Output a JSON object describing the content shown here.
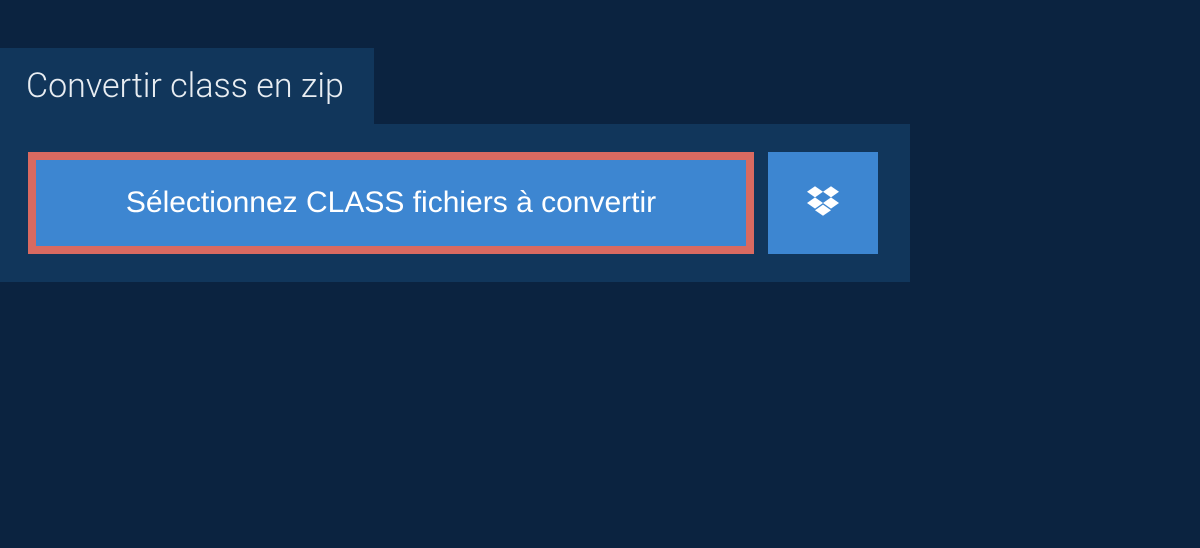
{
  "tab": {
    "label": "Convertir class en zip"
  },
  "actions": {
    "select_files_label": "Sélectionnez CLASS fichiers à convertir"
  },
  "colors": {
    "page_bg": "#0b2340",
    "panel_bg": "#11365b",
    "button_bg": "#3d86d1",
    "highlight_border": "#d96a61",
    "text_light": "#e8edf2",
    "text_white": "#ffffff"
  }
}
